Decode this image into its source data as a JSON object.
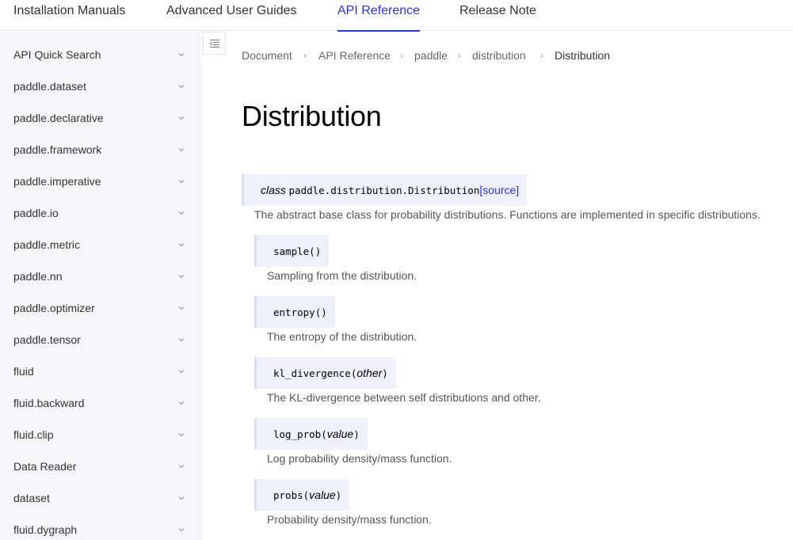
{
  "topnav": {
    "tabs": [
      {
        "label": "Installation Manuals"
      },
      {
        "label": "Advanced User Guides"
      },
      {
        "label": "API Reference",
        "active": true
      },
      {
        "label": "Release Note"
      }
    ]
  },
  "sidebar": {
    "items": [
      {
        "label": "API Quick Search"
      },
      {
        "label": "paddle.dataset"
      },
      {
        "label": "paddle.declarative"
      },
      {
        "label": "paddle.framework"
      },
      {
        "label": "paddle.imperative"
      },
      {
        "label": "paddle.io"
      },
      {
        "label": "paddle.metric"
      },
      {
        "label": "paddle.nn"
      },
      {
        "label": "paddle.optimizer"
      },
      {
        "label": "paddle.tensor"
      },
      {
        "label": "fluid"
      },
      {
        "label": "fluid.backward"
      },
      {
        "label": "fluid.clip"
      },
      {
        "label": "Data Reader"
      },
      {
        "label": "dataset"
      },
      {
        "label": "fluid.dygraph"
      }
    ],
    "chevron_icon": "chevron-down-icon",
    "collapse_icon": "menu-collapse-icon"
  },
  "breadcrumb": {
    "items": [
      "Document",
      "API Reference",
      "paddle",
      "distribution",
      "Distribution"
    ],
    "separator": "›"
  },
  "main": {
    "title": "Distribution",
    "class_sig": {
      "keyword": "class",
      "name": "paddle.distribution.Distribution",
      "source_link": "[source]",
      "description": "The abstract base class for probability distributions. Functions are implemented in specific distributions."
    },
    "methods": [
      {
        "name": "sample",
        "open": "(",
        "arg": "",
        "close": ")",
        "description": "Sampling from the distribution."
      },
      {
        "name": "entropy",
        "open": "(",
        "arg": "",
        "close": ")",
        "description": "The entropy of the distribution."
      },
      {
        "name": "kl_divergence",
        "open": "(",
        "arg": "other",
        "close": ")",
        "description": "The KL-divergence between self distributions and other."
      },
      {
        "name": "log_prob",
        "open": "(",
        "arg": "value",
        "close": ")",
        "description": "Log probability density/mass function."
      },
      {
        "name": "probs",
        "open": "(",
        "arg": "value",
        "close": ")",
        "description": "Probability density/mass function."
      }
    ]
  },
  "colors": {
    "accent": "#2932e1",
    "sidebar_bg": "#f5f6f9",
    "signature_bg": "#eef0fb"
  }
}
